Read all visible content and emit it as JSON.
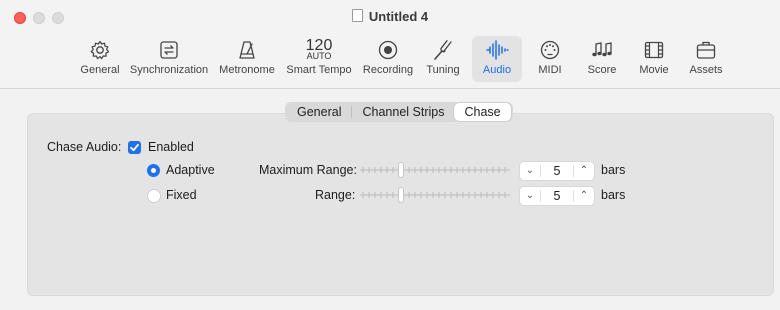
{
  "window": {
    "title": "Untitled 4",
    "colors": {
      "close": "#fe5f57",
      "accent": "#1e72f0"
    }
  },
  "toolbar": {
    "items": [
      {
        "label": "General",
        "icon": "gear-icon"
      },
      {
        "label": "Synchronization",
        "icon": "sync-icon"
      },
      {
        "label": "Metronome",
        "icon": "metronome-icon"
      },
      {
        "label": "Smart Tempo",
        "icon": "tempo-icon",
        "tempo": "120",
        "tempo_sub": "AUTO"
      },
      {
        "label": "Recording",
        "icon": "record-icon"
      },
      {
        "label": "Tuning",
        "icon": "tuning-fork-icon"
      },
      {
        "label": "Audio",
        "icon": "waveform-icon",
        "active": true
      },
      {
        "label": "MIDI",
        "icon": "midi-icon"
      },
      {
        "label": "Score",
        "icon": "music-notes-icon"
      },
      {
        "label": "Movie",
        "icon": "film-icon"
      },
      {
        "label": "Assets",
        "icon": "briefcase-icon"
      }
    ]
  },
  "tabs": {
    "items": [
      "General",
      "Channel Strips",
      "Chase"
    ],
    "selected": "Chase"
  },
  "chase": {
    "label": "Chase Audio:",
    "enabled_label": "Enabled",
    "enabled": true,
    "mode_adaptive": "Adaptive",
    "mode_fixed": "Fixed",
    "selected_mode": "Adaptive",
    "max_range_label": "Maximum Range:",
    "max_range_value": "5",
    "range_label": "Range:",
    "range_value": "5",
    "unit": "bars"
  }
}
